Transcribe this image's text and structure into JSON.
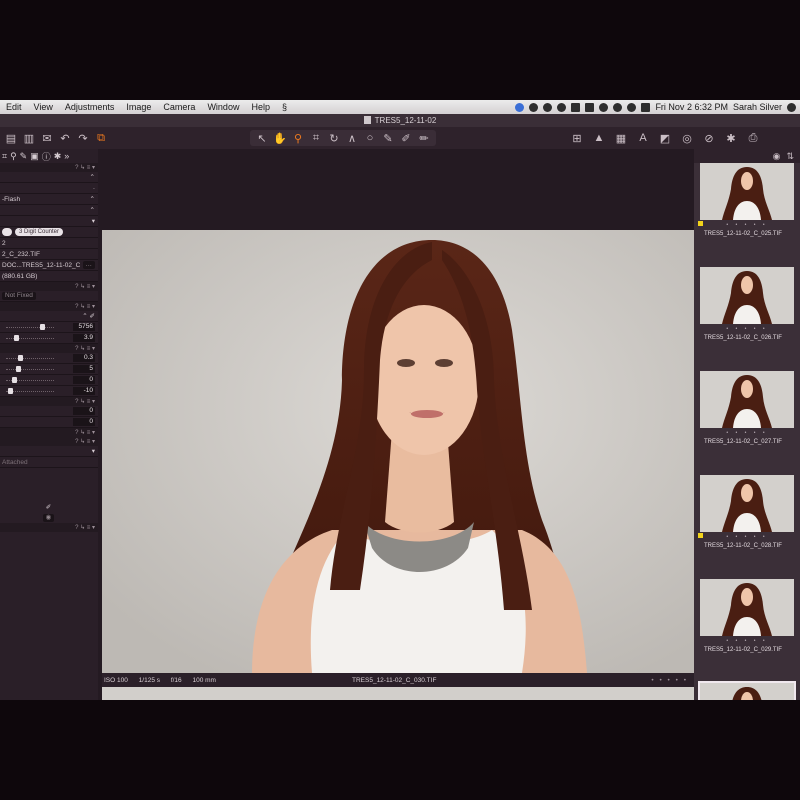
{
  "menubar": {
    "items": [
      "Edit",
      "View",
      "Adjustments",
      "Image",
      "Camera",
      "Window",
      "Help"
    ],
    "clock": "Fri Nov 2  6:32 PM",
    "user": "Sarah Silver"
  },
  "window": {
    "title": "TRES5_12-11-02"
  },
  "left_panel": {
    "flash_label": "-Flash",
    "counter_label": "3 Digit Counter",
    "row_2": "2",
    "file_name": "2_C_232.TIF",
    "path": "DOC...TRES5_12-11-02_C",
    "disk_space": "(880.61 GB)",
    "size_label": "Not Fixed",
    "kelvin": "5756",
    "tint": "3.9",
    "exposure_values": [
      "0.3",
      "5",
      "0",
      "-10"
    ],
    "level_values": [
      "0",
      "0"
    ],
    "attached_label": "Attached"
  },
  "viewer": {
    "iso": "ISO 100",
    "shutter": "1/125 s",
    "aperture": "f/16",
    "focal": "100 mm",
    "file": "TRES5_12-11-02_C_030.TIF",
    "rating_dots": "• • • • •"
  },
  "filmstrip": [
    {
      "caption": "TRES5_12-11-02_C_025.TIF",
      "tagged": true
    },
    {
      "caption": "TRES5_12-11-02_C_026.TIF",
      "tagged": false
    },
    {
      "caption": "TRES5_12-11-02_C_027.TIF",
      "tagged": false
    },
    {
      "caption": "TRES5_12-11-02_C_028.TIF",
      "tagged": true
    },
    {
      "caption": "TRES5_12-11-02_C_029.TIF",
      "tagged": false
    },
    {
      "caption": "",
      "tagged": false
    }
  ],
  "colors": {
    "accent": "#f07a1e",
    "tag": "#f2d31b",
    "backdrop": "#d2cfcb",
    "hair": "#4a1e12"
  }
}
